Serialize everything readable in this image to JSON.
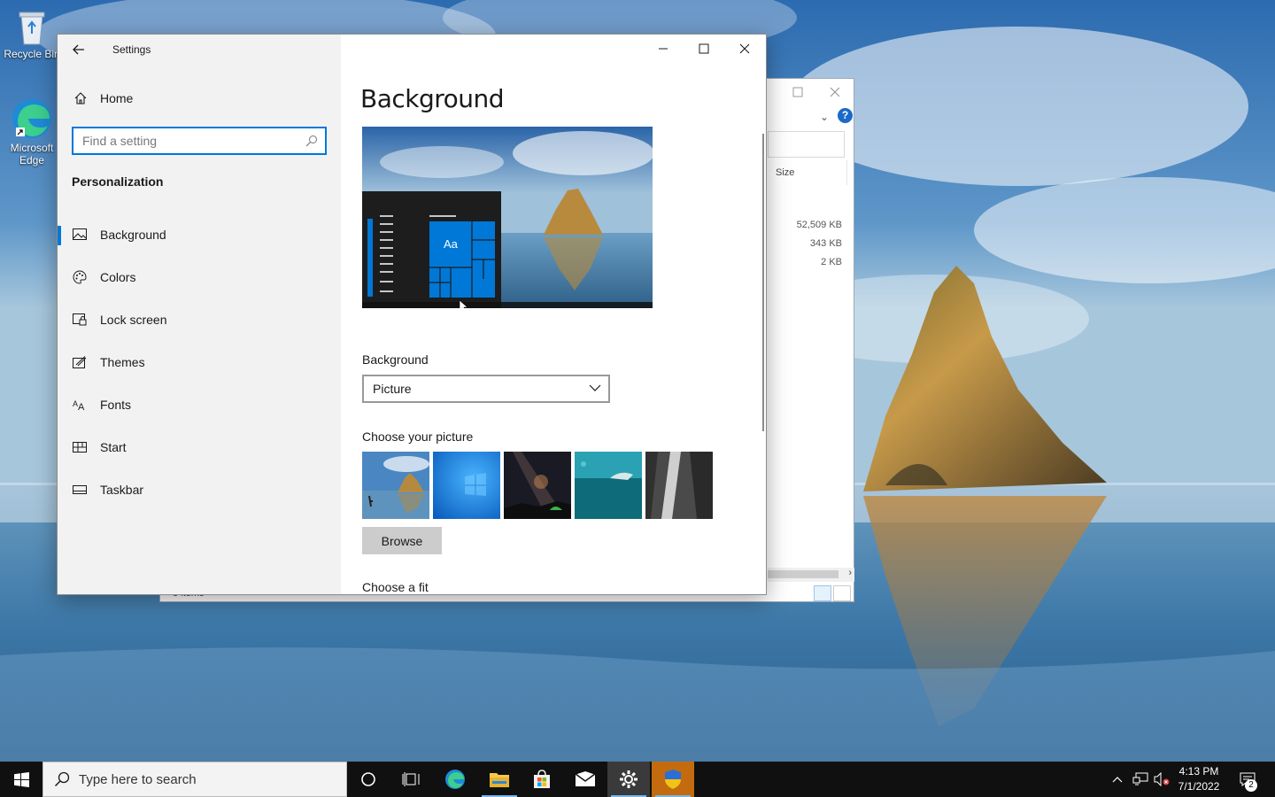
{
  "desktop": {
    "icons": [
      {
        "label": "Recycle Bin"
      },
      {
        "label": "Microsoft Edge"
      }
    ]
  },
  "explorer": {
    "size_header": "Size",
    "sizes": [
      "52,509 KB",
      "343 KB",
      "2 KB"
    ],
    "status": "3 items"
  },
  "settings": {
    "app_title": "Settings",
    "home_label": "Home",
    "search_placeholder": "Find a setting",
    "section_title": "Personalization",
    "nav_items": [
      {
        "label": "Background",
        "icon": "picture-icon",
        "active": true
      },
      {
        "label": "Colors",
        "icon": "palette-icon"
      },
      {
        "label": "Lock screen",
        "icon": "lock-screen-icon"
      },
      {
        "label": "Themes",
        "icon": "themes-icon"
      },
      {
        "label": "Fonts",
        "icon": "fonts-icon"
      },
      {
        "label": "Start",
        "icon": "start-icon"
      },
      {
        "label": "Taskbar",
        "icon": "taskbar-icon"
      }
    ],
    "page_title": "Background",
    "preview_tile_text": "Aa",
    "background_label": "Background",
    "background_value": "Picture",
    "choose_picture_label": "Choose your picture",
    "browse_label": "Browse",
    "choose_fit_label": "Choose a fit",
    "accent_color": "#0078d7"
  },
  "taskbar": {
    "search_placeholder": "Type here to search",
    "time": "4:13 PM",
    "date": "7/1/2022",
    "notification_count": "2"
  }
}
